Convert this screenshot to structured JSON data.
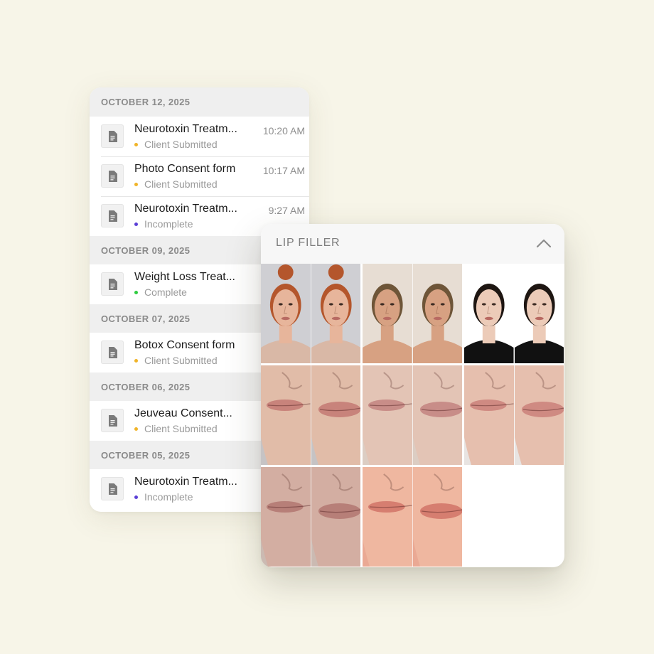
{
  "forms_list": {
    "groups": [
      {
        "date": "OCTOBER 12, 2025",
        "items": [
          {
            "title": "Neurotoxin Treatm...",
            "time": "10:20 AM",
            "status": "Client Submitted",
            "status_color": "#f0b429"
          },
          {
            "title": "Photo Consent form",
            "time": "10:17 AM",
            "status": "Client Submitted",
            "status_color": "#f0b429"
          },
          {
            "title": "Neurotoxin Treatm...",
            "time": "9:27 AM",
            "status": "Incomplete",
            "status_color": "#5b3fd6"
          }
        ]
      },
      {
        "date": "OCTOBER 09, 2025",
        "items": [
          {
            "title": "Weight Loss Treat...",
            "time": "",
            "status": "Complete",
            "status_color": "#2ecc40"
          }
        ]
      },
      {
        "date": "OCTOBER 07, 2025",
        "items": [
          {
            "title": "Botox Consent form",
            "time": "",
            "status": "Client Submitted",
            "status_color": "#f0b429"
          }
        ]
      },
      {
        "date": "OCTOBER 06, 2025",
        "items": [
          {
            "title": "Jeuveau Consent...",
            "time": "",
            "status": "Client Submitted",
            "status_color": "#f0b429"
          }
        ]
      },
      {
        "date": "OCTOBER 05, 2025",
        "items": [
          {
            "title": "Neurotoxin Treatm...",
            "time": "",
            "status": "Incomplete",
            "status_color": "#5b3fd6"
          }
        ]
      }
    ]
  },
  "gallery": {
    "title": "LIP FILLER",
    "toggle_icon": "chevron-up-icon",
    "photos": [
      {
        "name": "before-after-photo-1",
        "kind": "face",
        "skin": "#e7b59b",
        "bg": "#cfcfd3",
        "hair": "#b4562c",
        "shirt": "#d9b8a6"
      },
      {
        "name": "before-after-photo-2",
        "kind": "face",
        "skin": "#d7a182",
        "bg": "#e7ddd3",
        "hair": "#6e5538",
        "shirt": "#d7a182"
      },
      {
        "name": "before-after-photo-3",
        "kind": "face",
        "skin": "#eccbb8",
        "bg": "#ffffff",
        "hair": "#1e1612",
        "shirt": "#111111"
      },
      {
        "name": "before-after-photo-4",
        "kind": "lips",
        "skin": "#e1bca8",
        "bg": "#c6c3c4",
        "lip": "#c8837b"
      },
      {
        "name": "before-after-photo-5",
        "kind": "lips",
        "skin": "#e3c4b5",
        "bg": "#dccdc3",
        "lip": "#c88d88"
      },
      {
        "name": "before-after-photo-6",
        "kind": "lips",
        "skin": "#e6bfae",
        "bg": "#e8e4e2",
        "lip": "#cf8a82"
      },
      {
        "name": "before-after-photo-7",
        "kind": "lips",
        "skin": "#d3aea2",
        "bg": "#cbbab2",
        "lip": "#b77f78"
      },
      {
        "name": "before-after-photo-8",
        "kind": "lips",
        "skin": "#efb7a0",
        "bg": "#eaa994",
        "lip": "#d67e70"
      }
    ]
  }
}
